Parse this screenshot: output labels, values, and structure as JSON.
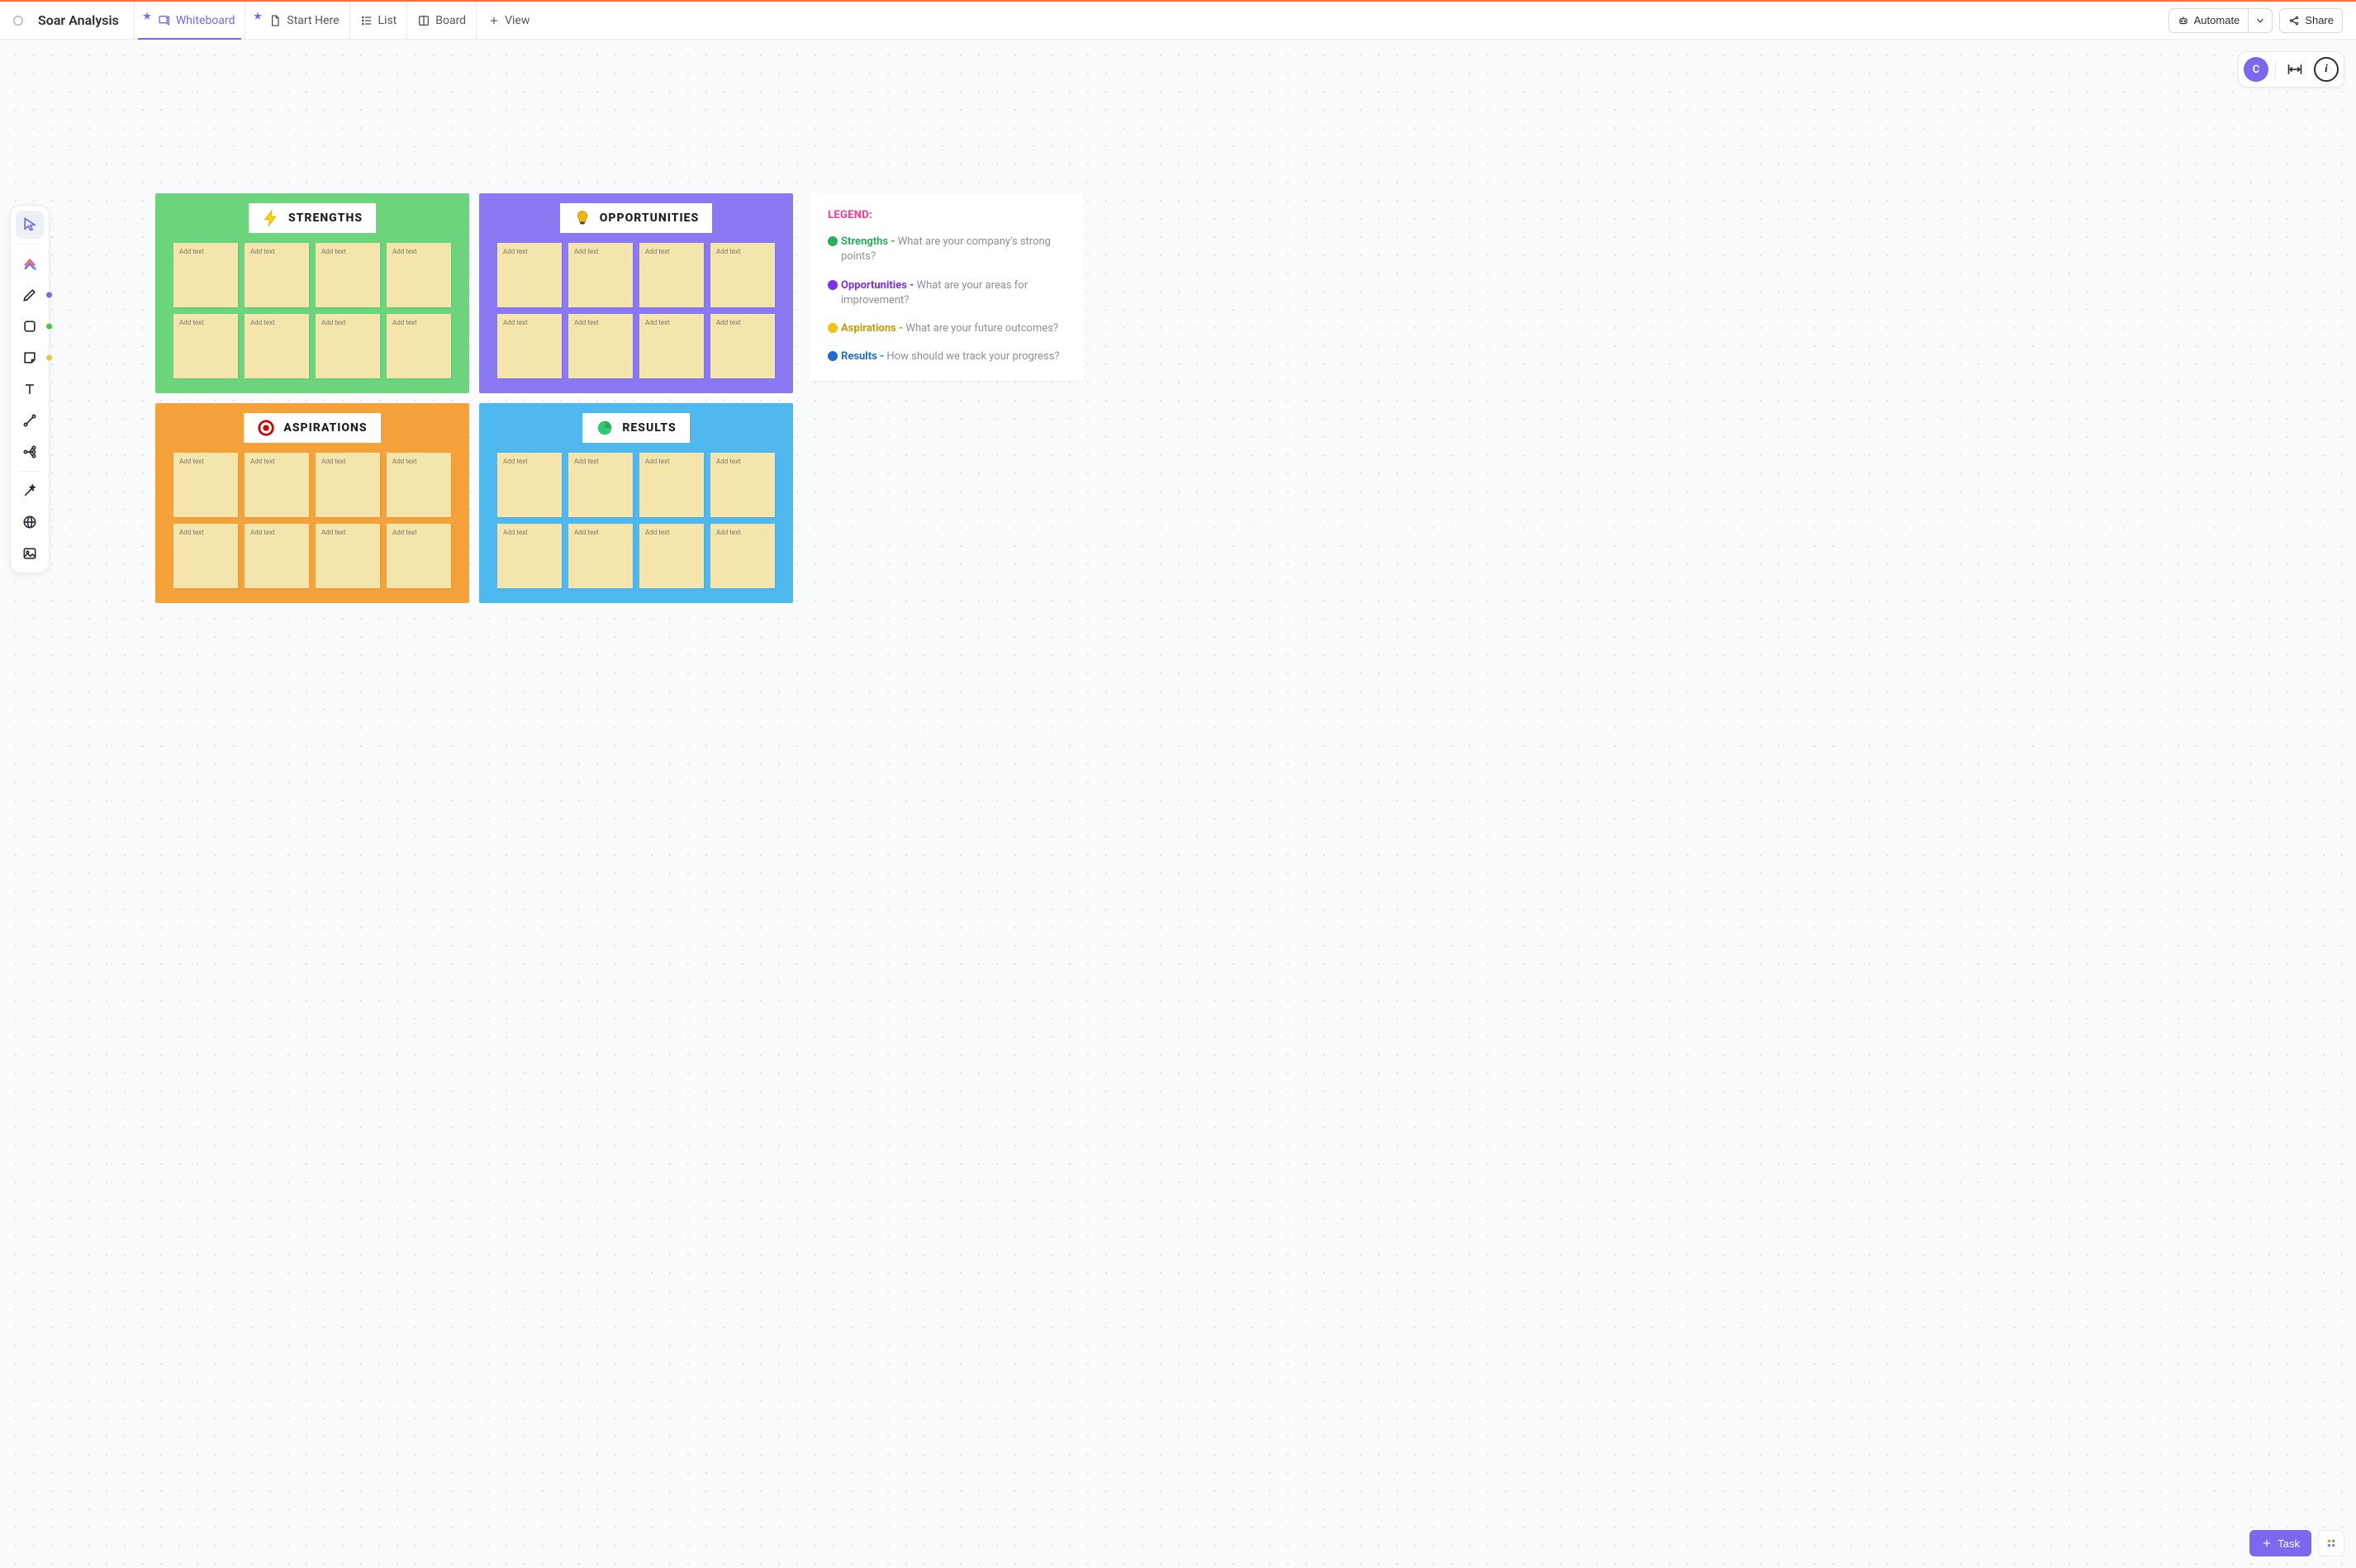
{
  "header": {
    "title": "Soar Analysis",
    "tabs": [
      {
        "label": "Whiteboard",
        "active": true,
        "starred": true
      },
      {
        "label": "Start Here",
        "active": false,
        "starred": true
      },
      {
        "label": "List",
        "active": false,
        "starred": false
      },
      {
        "label": "Board",
        "active": false,
        "starred": false
      }
    ],
    "add_view_label": "View",
    "automate_label": "Automate",
    "share_label": "Share"
  },
  "controls": {
    "avatar_initial": "C"
  },
  "toolbox": {
    "tools": [
      {
        "name": "select",
        "active": true
      },
      {
        "name": "clickup",
        "active": false
      },
      {
        "name": "pen",
        "active": false,
        "dot": "#7b68ee"
      },
      {
        "name": "shape",
        "active": false,
        "dot": "#49c940"
      },
      {
        "name": "sticky",
        "active": false,
        "dot": "#f5c245"
      },
      {
        "name": "text",
        "active": false
      },
      {
        "name": "connector",
        "active": false
      },
      {
        "name": "mindmap",
        "active": false
      },
      {
        "name": "magic",
        "active": false
      },
      {
        "name": "web",
        "active": false
      },
      {
        "name": "image",
        "active": false
      }
    ]
  },
  "soar": {
    "note_placeholder": "Add text",
    "boards": [
      {
        "key": "strengths",
        "title": "STRENGTHS",
        "bg": "#6dd47e",
        "icon": "bolt"
      },
      {
        "key": "opportunities",
        "title": "OPPORTUNITIES",
        "bg": "#8a79f3",
        "icon": "bulb"
      },
      {
        "key": "aspirations",
        "title": "ASPIRATIONS",
        "bg": "#f5a23b",
        "icon": "target"
      },
      {
        "key": "results",
        "title": "RESULTS",
        "bg": "#4fb8ef",
        "icon": "pie"
      }
    ]
  },
  "legend": {
    "title": "LEGEND:",
    "rows": [
      {
        "dot": "#27ae60",
        "term_color": "#27ae60",
        "term": "Strengths",
        "desc": "What are your company's strong points?"
      },
      {
        "dot": "#7b2ff2",
        "term_color": "#7b2ff2",
        "term": "Opportunities",
        "desc": "What are your areas for improvement?"
      },
      {
        "dot": "#f1c40f",
        "term_color": "#c99a06",
        "term": "Aspirations",
        "desc": "What are your future outcomes?"
      },
      {
        "dot": "#1f6bd6",
        "term_color": "#1f6bd6",
        "term": "Results",
        "desc": "How should we track your progress?"
      }
    ]
  },
  "task_button": {
    "label": "Task"
  }
}
